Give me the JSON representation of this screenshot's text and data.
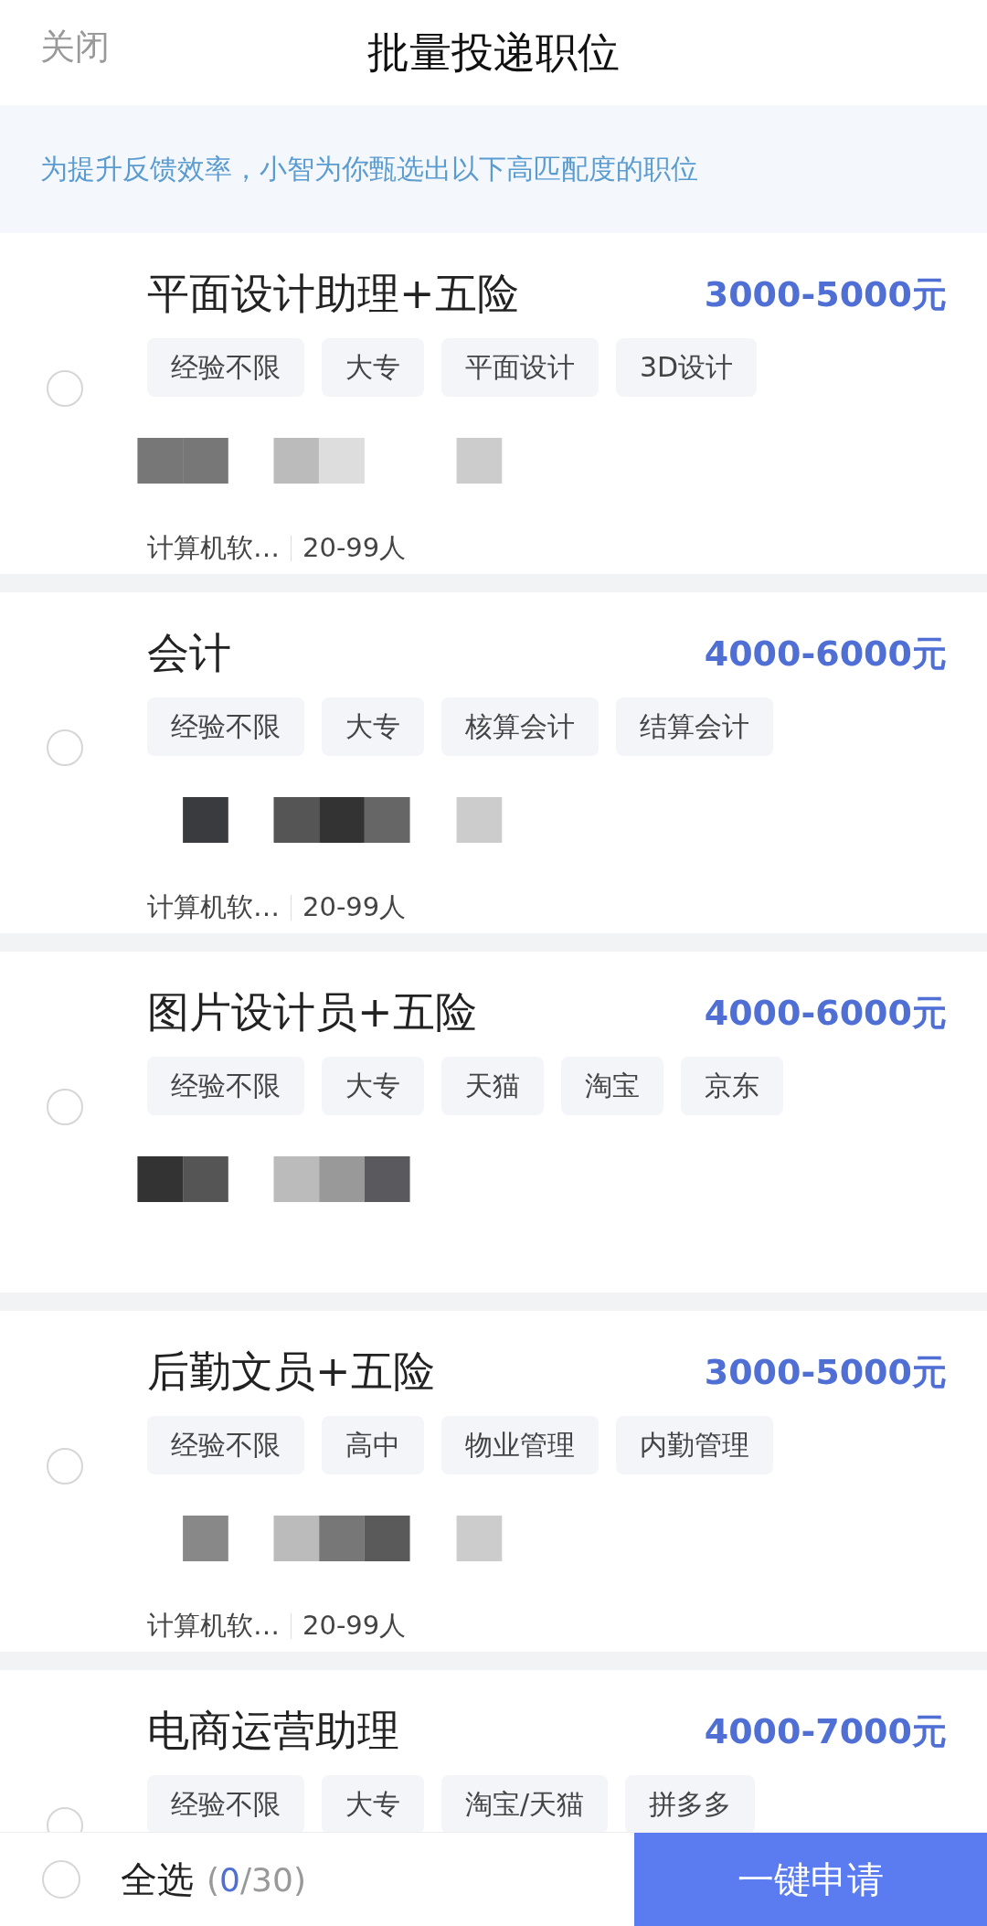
{
  "header": {
    "close": "关闭",
    "title": "批量投递职位"
  },
  "notice": "为提升反馈效率，小智为你甄选出以下高匹配度的职位",
  "jobs": [
    {
      "title": "平面设计助理+五险",
      "salary": "3000-5000元",
      "tags": [
        "经验不限",
        "大专",
        "平面设计",
        "3D设计"
      ],
      "company": "计算机软…",
      "size": "20-99人",
      "selected": false
    },
    {
      "title": "会计",
      "salary": "4000-6000元",
      "tags": [
        "经验不限",
        "大专",
        "核算会计",
        "结算会计"
      ],
      "company": "计算机软…",
      "size": "20-99人",
      "selected": false
    },
    {
      "title": "图片设计员+五险",
      "salary": "4000-6000元",
      "tags": [
        "经验不限",
        "大专",
        "天猫",
        "淘宝",
        "京东"
      ],
      "selected": false
    },
    {
      "title": "后勤文员+五险",
      "salary": "3000-5000元",
      "tags": [
        "经验不限",
        "高中",
        "物业管理",
        "内勤管理"
      ],
      "company": "计算机软…",
      "size": "20-99人",
      "selected": false
    },
    {
      "title": "电商运营助理",
      "salary": "4000-7000元",
      "tags": [
        "经验不限",
        "大专",
        "淘宝/天猫",
        "拼多多"
      ],
      "selected": false
    }
  ],
  "footer": {
    "select_all": {
      "label": "全选",
      "selected": false
    },
    "count_open": "(",
    "count": "0",
    "count_rest": "/30)",
    "apply": "一键申请"
  }
}
